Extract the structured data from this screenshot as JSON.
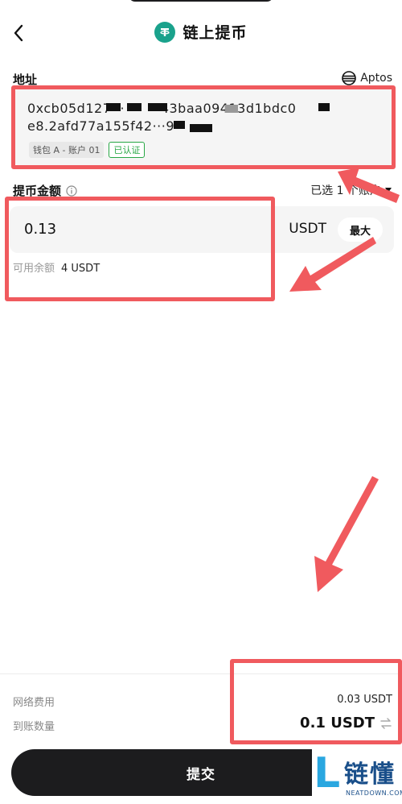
{
  "header": {
    "title": "链上提币",
    "back_icon": "chevron-left-icon",
    "coin_icon": "tether-icon"
  },
  "address": {
    "label": "地址",
    "network": "Aptos",
    "value_line1": "0xcb05d127··· ··· ···43baa09413d1bdc0",
    "value_line2": "e8.2afd77a155f42···9",
    "wallet_tag": "钱包 A - 账户 01",
    "verified_tag": "已认证"
  },
  "amount": {
    "label": "提币金额",
    "selected_text": "已选 1 个账户",
    "value": "0.13",
    "unit": "USDT",
    "max_label": "最大",
    "available_label": "可用余额",
    "available_value": "4 USDT"
  },
  "summary": {
    "fee_label": "网络费用",
    "fee_value": "0.03 USDT",
    "received_label": "到账数量",
    "received_value": "0.1 USDT"
  },
  "submit_label": "提交",
  "watermark": {
    "logo_letter": "L",
    "cn": "链懂",
    "en": "NEATDOWN.COM"
  },
  "colors": {
    "annotation": "#f05a5e",
    "coin": "#1aa28c",
    "verified": "#28a745",
    "button": "#1c1c1e"
  }
}
